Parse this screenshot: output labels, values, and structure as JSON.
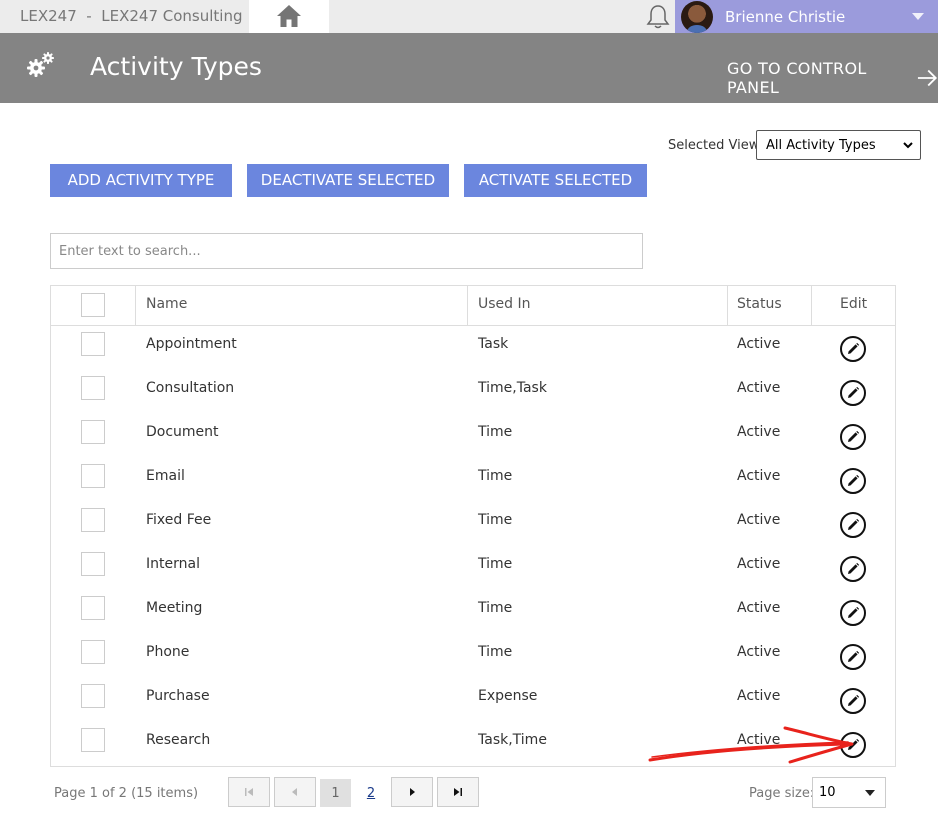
{
  "topbar": {
    "firm": "LEX247",
    "separator": "  -  ",
    "org": "LEX247 Consulting",
    "user_name": "Brienne Christie"
  },
  "header": {
    "title": "Activity Types",
    "control_panel_link": "GO TO CONTROL PANEL"
  },
  "view": {
    "label": "Selected View:",
    "selected": "All Activity Types"
  },
  "toolbar": {
    "add": "ADD ACTIVITY TYPE",
    "deactivate": "DEACTIVATE SELECTED",
    "activate": "ACTIVATE SELECTED"
  },
  "search": {
    "placeholder": "Enter text to search..."
  },
  "table": {
    "headers": {
      "name": "Name",
      "used_in": "Used In",
      "status": "Status",
      "edit": "Edit"
    },
    "rows": [
      {
        "name": "Appointment",
        "used_in": "Task",
        "status": "Active"
      },
      {
        "name": "Consultation",
        "used_in": "Time,Task",
        "status": "Active"
      },
      {
        "name": "Document",
        "used_in": "Time",
        "status": "Active"
      },
      {
        "name": "Email",
        "used_in": "Time",
        "status": "Active"
      },
      {
        "name": "Fixed Fee",
        "used_in": "Time",
        "status": "Active"
      },
      {
        "name": "Internal",
        "used_in": "Time",
        "status": "Active"
      },
      {
        "name": "Meeting",
        "used_in": "Time",
        "status": "Active"
      },
      {
        "name": "Phone",
        "used_in": "Time",
        "status": "Active"
      },
      {
        "name": "Purchase",
        "used_in": "Expense",
        "status": "Active"
      },
      {
        "name": "Research",
        "used_in": "Task,Time",
        "status": "Active"
      }
    ]
  },
  "pager": {
    "info": "Page 1 of 2 (15 items)",
    "current_page": "1",
    "next_page": "2",
    "page_size_label": "Page size:",
    "page_size": "10"
  },
  "colors": {
    "button_bg": "#6b86de",
    "header_bg": "#848484",
    "user_area_bg": "#9b9bdc",
    "annotation_arrow": "#e8231c"
  }
}
